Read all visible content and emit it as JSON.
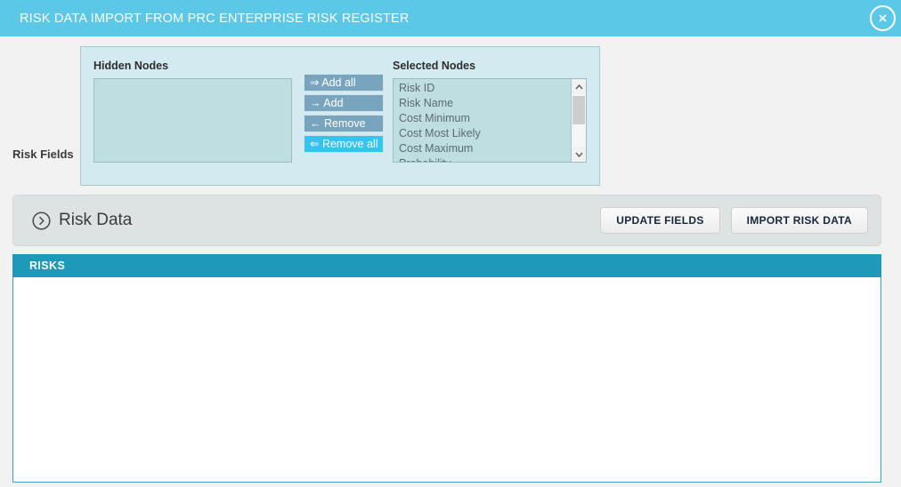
{
  "window": {
    "title": "RISK DATA IMPORT FROM PRC ENTERPRISE RISK REGISTER",
    "close_label": "×",
    "header_color": "#5bc8e8"
  },
  "risk_fields": {
    "section_label": "Risk Fields",
    "hidden_nodes": {
      "title": "Hidden Nodes",
      "items": []
    },
    "selected_nodes": {
      "title": "Selected Nodes",
      "items": [
        "Risk ID",
        "Risk Name",
        "Cost Minimum",
        "Cost Most Likely",
        "Cost Maximum",
        "Probability"
      ]
    },
    "transfer_buttons": [
      {
        "label": "⇒ Add all",
        "state": "normal"
      },
      {
        "label": "→ Add",
        "state": "normal"
      },
      {
        "label": "← Remove",
        "state": "normal"
      },
      {
        "label": "⇐ Remove all",
        "state": "active"
      }
    ],
    "panel_color": "#d3eaf0",
    "listbox_color": "#bfdee2",
    "button_color": "#78a5bd",
    "button_active_color": "#36c4ef"
  },
  "risk_data": {
    "icon": "chevron-right-circle-icon",
    "label": "Risk Data",
    "buttons": [
      {
        "label": "UPDATE FIELDS"
      },
      {
        "label": "IMPORT RISK DATA"
      }
    ]
  },
  "risks_grid": {
    "header_label": "RISKS",
    "header_color": "#1f99b9",
    "rows": []
  }
}
